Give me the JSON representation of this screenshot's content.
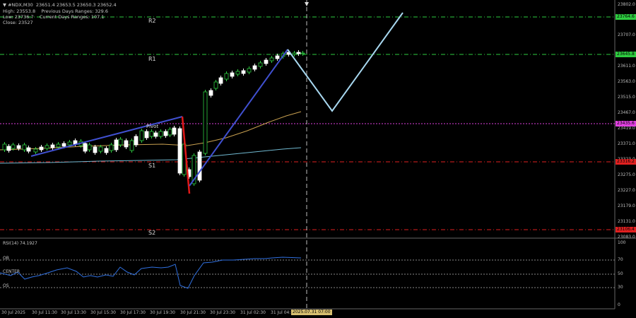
{
  "info": {
    "symbol_line": "▼ #NDX,M30  23651.4 23653.5 23650.3 23652.4",
    "line2": "High: 23553.8    Previous Days Ranges: 329.6",
    "line3": "Low: 23736.7    Current Days Ranges: 107.1",
    "line4": "Close: 23527"
  },
  "levels": {
    "r2": {
      "label": "R2",
      "price": 23764.6,
      "color": "#2ecc40",
      "tag": "23764.6"
    },
    "r1": {
      "label": "R1",
      "price": 23645.8,
      "color": "#2ecc40",
      "tag": "23645.8"
    },
    "pivot": {
      "label": "Pivot",
      "price": 23435.6,
      "color": "#e040e0",
      "tag": "23435.6"
    },
    "s1": {
      "label": "S1",
      "price": 23316.2,
      "color": "#e02020",
      "tag": "23316.2"
    },
    "s2": {
      "label": "S2",
      "price": 23106.4,
      "color": "#e02020",
      "tag": "23106.4"
    }
  },
  "price_axis": [
    "23802.0",
    "23707.0",
    "23611.0",
    "23563.0",
    "23515.0",
    "23467.0",
    "23419.0",
    "23371.0",
    "23323.0",
    "23275.0",
    "23227.0",
    "23179.0",
    "23131.0",
    "23083.0"
  ],
  "time_axis": [
    "30 Jul 2025",
    "30 Jul 11:30",
    "30 Jul 13:30",
    "30 Jul 15:30",
    "30 Jul 17:30",
    "30 Jul 19:30",
    "30 Jul 21:30",
    "30 Jul 23:30",
    "31 Jul 02:30",
    "31 Jul 04:"
  ],
  "time_cursor": "2025.07.31 07:00",
  "rsi": {
    "title": "RSI(14) 74.1927",
    "ob": "OB",
    "center": "CENTER",
    "os": "OS",
    "scale": [
      "100",
      "70",
      "50",
      "30",
      "0"
    ]
  },
  "colors": {
    "bull_candle": "#000000",
    "bear_candle": "#ffffff",
    "candle_outline_up": "#2ecc40",
    "ma_fast": "#c8a050",
    "ma_slow": "#70b8d0",
    "trend_blue": "#4050d0",
    "trend_red": "#e01818",
    "projection": "#a8d8f0",
    "rsi_line": "#3070e0"
  }
}
